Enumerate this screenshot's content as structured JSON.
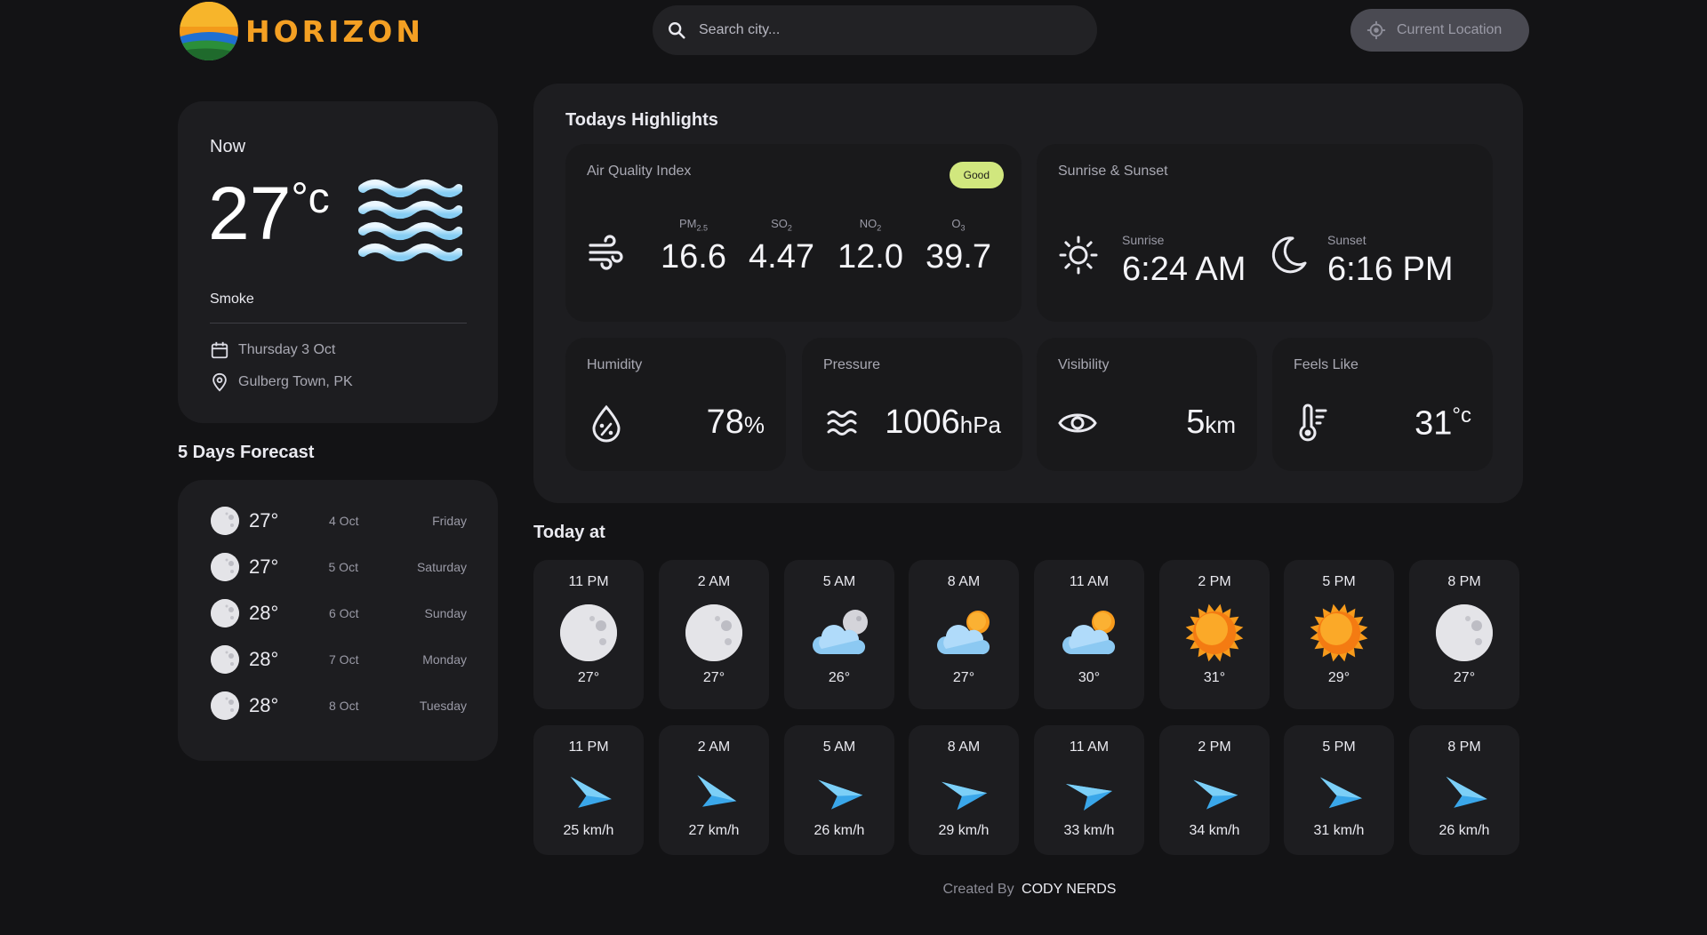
{
  "header": {
    "app_name": "HORIZON",
    "search_placeholder": "Search city...",
    "location_button": "Current Location"
  },
  "current": {
    "label": "Now",
    "temp": "27",
    "unit": "°c",
    "condition": "Smoke",
    "date": "Thursday 3 Oct",
    "location": "Gulberg Town, PK",
    "icon": "fog-waves-icon"
  },
  "forecast": {
    "title": "5 Days Forecast",
    "days": [
      {
        "temp": "27°",
        "date": "4 Oct",
        "day": "Friday",
        "icon": "moon-icon"
      },
      {
        "temp": "27°",
        "date": "5 Oct",
        "day": "Saturday",
        "icon": "moon-icon"
      },
      {
        "temp": "28°",
        "date": "6 Oct",
        "day": "Sunday",
        "icon": "moon-icon"
      },
      {
        "temp": "28°",
        "date": "7 Oct",
        "day": "Monday",
        "icon": "moon-icon"
      },
      {
        "temp": "28°",
        "date": "8 Oct",
        "day": "Tuesday",
        "icon": "moon-icon"
      }
    ]
  },
  "highlights": {
    "title": "Todays Highlights",
    "aqi": {
      "label": "Air Quality Index",
      "badge": "Good",
      "items": [
        {
          "key": "PM2.5",
          "sub": "2.5",
          "base": "PM",
          "value": "16.6"
        },
        {
          "key": "SO2",
          "sub": "2",
          "base": "SO",
          "value": "4.47"
        },
        {
          "key": "NO2",
          "sub": "2",
          "base": "NO",
          "value": "12.0"
        },
        {
          "key": "O3",
          "sub": "3",
          "base": "O",
          "value": "39.7"
        }
      ]
    },
    "sun": {
      "label": "Sunrise & Sunset",
      "sunrise_label": "Sunrise",
      "sunrise": "6:24 AM",
      "sunset_label": "Sunset",
      "sunset": "6:16 PM"
    },
    "humidity": {
      "label": "Humidity",
      "value": "78",
      "unit": "%"
    },
    "pressure": {
      "label": "Pressure",
      "value": "1006",
      "unit": "hPa"
    },
    "visibility": {
      "label": "Visibility",
      "value": "5",
      "unit": "km"
    },
    "feels_like": {
      "label": "Feels Like",
      "value": "31",
      "unit": "°c"
    }
  },
  "today": {
    "title": "Today at",
    "temps": [
      {
        "time": "11 PM",
        "temp": "27°",
        "icon": "moon-icon"
      },
      {
        "time": "2 AM",
        "temp": "27°",
        "icon": "moon-icon"
      },
      {
        "time": "5 AM",
        "temp": "26°",
        "icon": "cloud-moon-icon"
      },
      {
        "time": "8 AM",
        "temp": "27°",
        "icon": "cloud-sun-icon"
      },
      {
        "time": "11 AM",
        "temp": "30°",
        "icon": "cloud-sun-icon"
      },
      {
        "time": "2 PM",
        "temp": "31°",
        "icon": "sun-icon"
      },
      {
        "time": "5 PM",
        "temp": "29°",
        "icon": "sun-icon"
      },
      {
        "time": "8 PM",
        "temp": "27°",
        "icon": "moon-icon"
      }
    ],
    "winds": [
      {
        "time": "11 PM",
        "speed": "25 km/h",
        "deg": 20
      },
      {
        "time": "2 AM",
        "speed": "27 km/h",
        "deg": 25
      },
      {
        "time": "5 AM",
        "speed": "26 km/h",
        "deg": 10
      },
      {
        "time": "8 AM",
        "speed": "29 km/h",
        "deg": 5
      },
      {
        "time": "11 AM",
        "speed": "33 km/h",
        "deg": 0
      },
      {
        "time": "2 PM",
        "speed": "34 km/h",
        "deg": 10
      },
      {
        "time": "5 PM",
        "speed": "31 km/h",
        "deg": 18
      },
      {
        "time": "8 PM",
        "speed": "26 km/h",
        "deg": 20
      }
    ]
  },
  "footer": {
    "prefix": "Created By",
    "author": "CODY NERDS"
  },
  "colors": {
    "background": "#131315",
    "card": "#1d1d20",
    "accent_logo": "#f4a023",
    "badge_good": "#d1e77e"
  }
}
